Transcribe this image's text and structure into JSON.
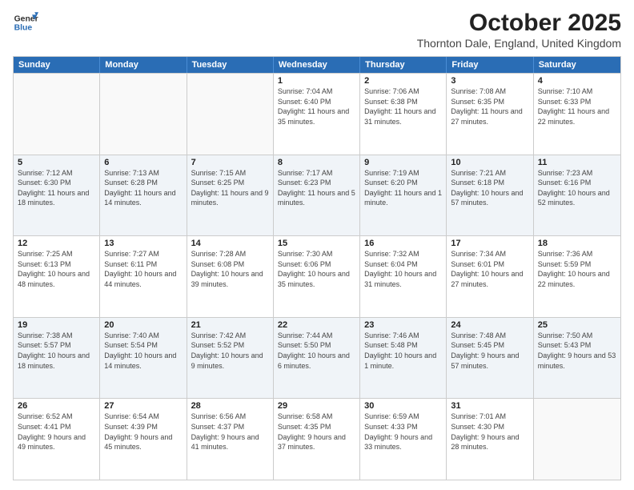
{
  "logo": {
    "line1": "General",
    "line2": "Blue"
  },
  "header": {
    "title": "October 2025",
    "subtitle": "Thornton Dale, England, United Kingdom"
  },
  "weekdays": [
    "Sunday",
    "Monday",
    "Tuesday",
    "Wednesday",
    "Thursday",
    "Friday",
    "Saturday"
  ],
  "rows": [
    [
      {
        "day": "",
        "sunrise": "",
        "sunset": "",
        "daylight": ""
      },
      {
        "day": "",
        "sunrise": "",
        "sunset": "",
        "daylight": ""
      },
      {
        "day": "",
        "sunrise": "",
        "sunset": "",
        "daylight": ""
      },
      {
        "day": "1",
        "sunrise": "Sunrise: 7:04 AM",
        "sunset": "Sunset: 6:40 PM",
        "daylight": "Daylight: 11 hours and 35 minutes."
      },
      {
        "day": "2",
        "sunrise": "Sunrise: 7:06 AM",
        "sunset": "Sunset: 6:38 PM",
        "daylight": "Daylight: 11 hours and 31 minutes."
      },
      {
        "day": "3",
        "sunrise": "Sunrise: 7:08 AM",
        "sunset": "Sunset: 6:35 PM",
        "daylight": "Daylight: 11 hours and 27 minutes."
      },
      {
        "day": "4",
        "sunrise": "Sunrise: 7:10 AM",
        "sunset": "Sunset: 6:33 PM",
        "daylight": "Daylight: 11 hours and 22 minutes."
      }
    ],
    [
      {
        "day": "5",
        "sunrise": "Sunrise: 7:12 AM",
        "sunset": "Sunset: 6:30 PM",
        "daylight": "Daylight: 11 hours and 18 minutes."
      },
      {
        "day": "6",
        "sunrise": "Sunrise: 7:13 AM",
        "sunset": "Sunset: 6:28 PM",
        "daylight": "Daylight: 11 hours and 14 minutes."
      },
      {
        "day": "7",
        "sunrise": "Sunrise: 7:15 AM",
        "sunset": "Sunset: 6:25 PM",
        "daylight": "Daylight: 11 hours and 9 minutes."
      },
      {
        "day": "8",
        "sunrise": "Sunrise: 7:17 AM",
        "sunset": "Sunset: 6:23 PM",
        "daylight": "Daylight: 11 hours and 5 minutes."
      },
      {
        "day": "9",
        "sunrise": "Sunrise: 7:19 AM",
        "sunset": "Sunset: 6:20 PM",
        "daylight": "Daylight: 11 hours and 1 minute."
      },
      {
        "day": "10",
        "sunrise": "Sunrise: 7:21 AM",
        "sunset": "Sunset: 6:18 PM",
        "daylight": "Daylight: 10 hours and 57 minutes."
      },
      {
        "day": "11",
        "sunrise": "Sunrise: 7:23 AM",
        "sunset": "Sunset: 6:16 PM",
        "daylight": "Daylight: 10 hours and 52 minutes."
      }
    ],
    [
      {
        "day": "12",
        "sunrise": "Sunrise: 7:25 AM",
        "sunset": "Sunset: 6:13 PM",
        "daylight": "Daylight: 10 hours and 48 minutes."
      },
      {
        "day": "13",
        "sunrise": "Sunrise: 7:27 AM",
        "sunset": "Sunset: 6:11 PM",
        "daylight": "Daylight: 10 hours and 44 minutes."
      },
      {
        "day": "14",
        "sunrise": "Sunrise: 7:28 AM",
        "sunset": "Sunset: 6:08 PM",
        "daylight": "Daylight: 10 hours and 39 minutes."
      },
      {
        "day": "15",
        "sunrise": "Sunrise: 7:30 AM",
        "sunset": "Sunset: 6:06 PM",
        "daylight": "Daylight: 10 hours and 35 minutes."
      },
      {
        "day": "16",
        "sunrise": "Sunrise: 7:32 AM",
        "sunset": "Sunset: 6:04 PM",
        "daylight": "Daylight: 10 hours and 31 minutes."
      },
      {
        "day": "17",
        "sunrise": "Sunrise: 7:34 AM",
        "sunset": "Sunset: 6:01 PM",
        "daylight": "Daylight: 10 hours and 27 minutes."
      },
      {
        "day": "18",
        "sunrise": "Sunrise: 7:36 AM",
        "sunset": "Sunset: 5:59 PM",
        "daylight": "Daylight: 10 hours and 22 minutes."
      }
    ],
    [
      {
        "day": "19",
        "sunrise": "Sunrise: 7:38 AM",
        "sunset": "Sunset: 5:57 PM",
        "daylight": "Daylight: 10 hours and 18 minutes."
      },
      {
        "day": "20",
        "sunrise": "Sunrise: 7:40 AM",
        "sunset": "Sunset: 5:54 PM",
        "daylight": "Daylight: 10 hours and 14 minutes."
      },
      {
        "day": "21",
        "sunrise": "Sunrise: 7:42 AM",
        "sunset": "Sunset: 5:52 PM",
        "daylight": "Daylight: 10 hours and 9 minutes."
      },
      {
        "day": "22",
        "sunrise": "Sunrise: 7:44 AM",
        "sunset": "Sunset: 5:50 PM",
        "daylight": "Daylight: 10 hours and 6 minutes."
      },
      {
        "day": "23",
        "sunrise": "Sunrise: 7:46 AM",
        "sunset": "Sunset: 5:48 PM",
        "daylight": "Daylight: 10 hours and 1 minute."
      },
      {
        "day": "24",
        "sunrise": "Sunrise: 7:48 AM",
        "sunset": "Sunset: 5:45 PM",
        "daylight": "Daylight: 9 hours and 57 minutes."
      },
      {
        "day": "25",
        "sunrise": "Sunrise: 7:50 AM",
        "sunset": "Sunset: 5:43 PM",
        "daylight": "Daylight: 9 hours and 53 minutes."
      }
    ],
    [
      {
        "day": "26",
        "sunrise": "Sunrise: 6:52 AM",
        "sunset": "Sunset: 4:41 PM",
        "daylight": "Daylight: 9 hours and 49 minutes."
      },
      {
        "day": "27",
        "sunrise": "Sunrise: 6:54 AM",
        "sunset": "Sunset: 4:39 PM",
        "daylight": "Daylight: 9 hours and 45 minutes."
      },
      {
        "day": "28",
        "sunrise": "Sunrise: 6:56 AM",
        "sunset": "Sunset: 4:37 PM",
        "daylight": "Daylight: 9 hours and 41 minutes."
      },
      {
        "day": "29",
        "sunrise": "Sunrise: 6:58 AM",
        "sunset": "Sunset: 4:35 PM",
        "daylight": "Daylight: 9 hours and 37 minutes."
      },
      {
        "day": "30",
        "sunrise": "Sunrise: 6:59 AM",
        "sunset": "Sunset: 4:33 PM",
        "daylight": "Daylight: 9 hours and 33 minutes."
      },
      {
        "day": "31",
        "sunrise": "Sunrise: 7:01 AM",
        "sunset": "Sunset: 4:30 PM",
        "daylight": "Daylight: 9 hours and 28 minutes."
      },
      {
        "day": "",
        "sunrise": "",
        "sunset": "",
        "daylight": ""
      }
    ]
  ]
}
